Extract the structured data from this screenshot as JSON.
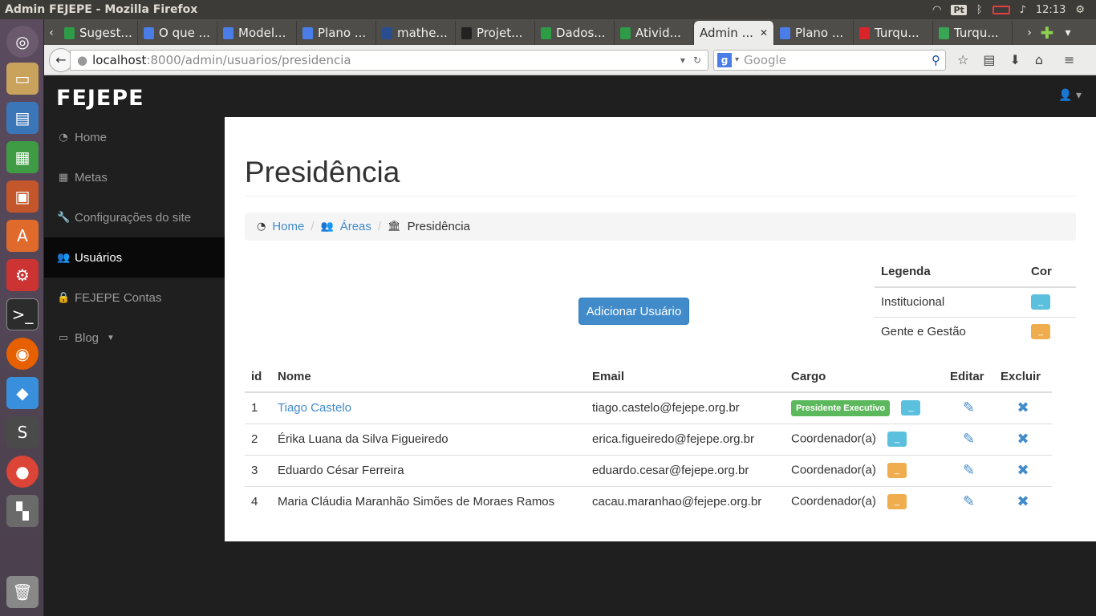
{
  "os": {
    "window_title": "Admin FEJEPE - Mozilla Firefox",
    "keyboard": "Pt",
    "clock": "12:13"
  },
  "browser": {
    "tabs": [
      {
        "label": "Sugest...",
        "color": "#2e9b47"
      },
      {
        "label": "O que ...",
        "color": "#4a7de8"
      },
      {
        "label": "Model...",
        "color": "#4a7de8"
      },
      {
        "label": "Plano ...",
        "color": "#4a7de8"
      },
      {
        "label": "mathe...",
        "color": "#2a4d8f"
      },
      {
        "label": "Projet...",
        "color": "#222222"
      },
      {
        "label": "Dados...",
        "color": "#2e9b47"
      },
      {
        "label": "Ativid...",
        "color": "#2e9b47"
      },
      {
        "label": "Admin ...",
        "color": "#ececea",
        "active": true
      },
      {
        "label": "Plano ...",
        "color": "#4a7de8"
      },
      {
        "label": "Turqu...",
        "color": "#d9252a"
      },
      {
        "label": "Turqu...",
        "color": "#3aa655"
      }
    ],
    "url_host": "localhost",
    "url_rest": ":8000/admin/usuarios/presidencia",
    "search_placeholder": "Google"
  },
  "app": {
    "logo": "FEJEPE",
    "sidebar": [
      {
        "label": "Home",
        "icon": "dashboard-icon"
      },
      {
        "label": "Metas",
        "icon": "table-icon"
      },
      {
        "label": "Configurações do site",
        "icon": "wrench-icon"
      },
      {
        "label": "Usuários",
        "icon": "users-icon",
        "active": true
      },
      {
        "label": "FEJEPE Contas",
        "icon": "lock-icon"
      },
      {
        "label": "Blog",
        "icon": "monitor-icon"
      }
    ]
  },
  "page": {
    "title": "Presidência",
    "breadcrumb": {
      "home": "Home",
      "areas": "Áreas",
      "current": "Presidência"
    },
    "add_button": "Adicionar Usuário",
    "legend": {
      "header_label": "Legenda",
      "header_color": "Cor",
      "rows": [
        {
          "label": "Institucional",
          "color": "#5bc0de"
        },
        {
          "label": "Gente e Gestão",
          "color": "#f0ad4e"
        }
      ]
    },
    "table": {
      "headers": {
        "id": "id",
        "nome": "Nome",
        "email": "Email",
        "cargo": "Cargo",
        "editar": "Editar",
        "excluir": "Excluir"
      },
      "rows": [
        {
          "id": "1",
          "nome": "Tiago Castelo",
          "email": "tiago.castelo@fejepe.org.br",
          "cargo": "Presidente Executivo",
          "color": "#5bc0de"
        },
        {
          "id": "2",
          "nome": "Érika Luana da Silva Figueiredo",
          "email": "erica.figueiredo@fejepe.org.br",
          "cargo": "Coordenador(a)",
          "color": "#5bc0de"
        },
        {
          "id": "3",
          "nome": "Eduardo César Ferreira",
          "email": "eduardo.cesar@fejepe.org.br",
          "cargo": "Coordenador(a)",
          "color": "#f0ad4e"
        },
        {
          "id": "4",
          "nome": "Maria Cláudia Maranhão Simões de Moraes Ramos",
          "email": "cacau.maranhao@fejepe.org.br",
          "cargo": "Coordenador(a)",
          "color": "#f0ad4e"
        }
      ]
    }
  }
}
